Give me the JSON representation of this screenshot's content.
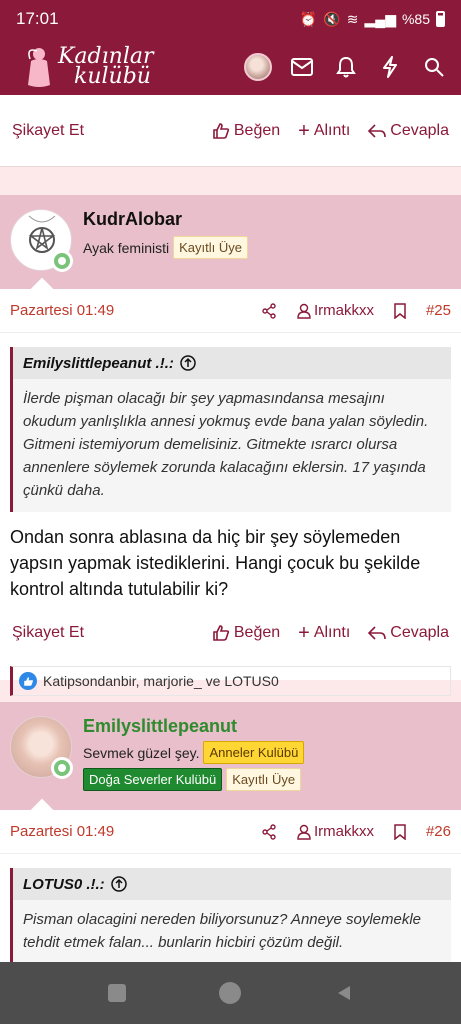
{
  "status": {
    "time": "17:01",
    "battery": "%85"
  },
  "header": {
    "logo_line1": "Kadınlar",
    "logo_line2": "kulübü"
  },
  "top_actions": {
    "report": "Şikayet Et",
    "like": "Beğen",
    "quote": "Alıntı",
    "reply": "Cevapla"
  },
  "posts": [
    {
      "username": "KudrAlobar",
      "usertitle": "Ayak feministi",
      "badges": [
        "Kayıtlı Üye"
      ],
      "date": "Pazartesi 01:49",
      "mention": "Irmakkxx",
      "number": "#25",
      "quote_author": "Emilyslittlepeanut .!.:",
      "quote_text": "İlerde pişman olacağı bir şey yapmasındansa mesajını okudum yanlışlıkla annesi yokmuş evde bana yalan söyledin. Gitmeni istemiyorum demelisiniz. Gitmekte ısrarcı olursa annenlere söylemek zorunda kalacağını eklersin. 17 yaşında çünkü daha.",
      "text": "Ondan sonra ablasına da hiç bir şey söylemeden yapsın yapmak istediklerini. Hangi çocuk bu şekilde kontrol altında tutulabilir ki?",
      "actions": {
        "report": "Şikayet Et",
        "like": "Beğen",
        "quote": "Alıntı",
        "reply": "Cevapla"
      },
      "reactions": "Katipsondanbir, marjorie_ ve LOTUS0"
    },
    {
      "username": "Emilyslittlepeanut",
      "usertitle": "Sevmek güzel şey.",
      "badges": [
        "Anneler Kulübü",
        "Doğa Severler Kulübü",
        "Kayıtlı Üye"
      ],
      "date": "Pazartesi 01:49",
      "mention": "Irmakkxx",
      "number": "#26",
      "quote_author": "LOTUS0 .!.:",
      "quote_text": "Pisman olacagini nereden biliyorsunuz? Anneye soylemekle tehdit etmek falan... bunlarin hicbiri çözüm değil."
    }
  ],
  "colors": {
    "brand": "#8b1a3a",
    "userbar": "#e8bfcb",
    "accent": "#c0392b"
  }
}
